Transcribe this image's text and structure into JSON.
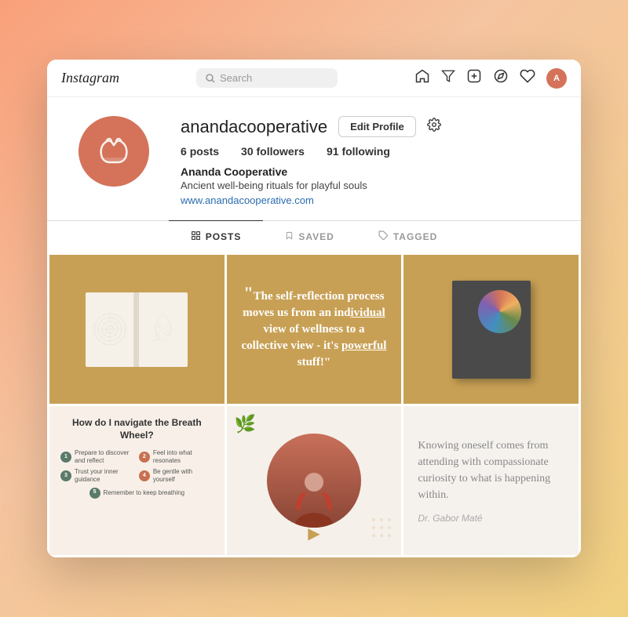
{
  "app": {
    "name": "Instagram"
  },
  "topbar": {
    "logo": "Instagram",
    "search_placeholder": "Search",
    "icons": [
      "home",
      "filter",
      "add",
      "compass",
      "heart",
      "avatar"
    ]
  },
  "profile": {
    "username": "anandacooperative",
    "edit_button": "Edit Profile",
    "stats": {
      "posts_label": "posts",
      "posts_count": "6",
      "followers_label": "followers",
      "followers_count": "30",
      "following_label": "following",
      "following_count": "91"
    },
    "display_name": "Ananda Cooperative",
    "bio": "Ancient well-being rituals for playful souls",
    "website": "www.anandacooperative.com"
  },
  "tabs": [
    {
      "id": "posts",
      "label": "POSTS",
      "active": true
    },
    {
      "id": "saved",
      "label": "SAVED",
      "active": false
    },
    {
      "id": "tagged",
      "label": "TAGGED",
      "active": false
    }
  ],
  "posts": [
    {
      "id": 1,
      "type": "book-open"
    },
    {
      "id": 2,
      "type": "quote",
      "text": "\"The self-reflection process moves us from an individual view of wellness to a collective view - it's powerful stuff!\""
    },
    {
      "id": 3,
      "type": "book-cover"
    },
    {
      "id": 4,
      "type": "breath-wheel",
      "title": "How do I navigate the Breath Wheel?",
      "steps": [
        {
          "num": "1",
          "text": "Prepare to discover and reflect"
        },
        {
          "num": "2",
          "text": "Feel into what resonates"
        },
        {
          "num": "3",
          "text": "Trust your inner guidance"
        },
        {
          "num": "4",
          "text": "Be gentle with yourself"
        },
        {
          "num": "5",
          "text": "Remember to keep breathing"
        }
      ]
    },
    {
      "id": 5,
      "type": "person"
    },
    {
      "id": 6,
      "type": "quote2",
      "text": "Knowing oneself comes from attending with compassionate curiosity to what is happening within.",
      "author": "Dr. Gabor Maté"
    }
  ]
}
